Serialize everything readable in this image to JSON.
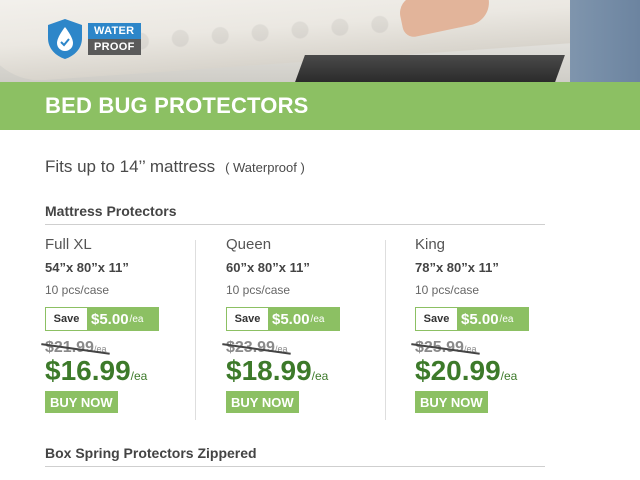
{
  "badge": {
    "line1": "WATER",
    "line2": "PROOF"
  },
  "banner": {
    "title": "BED BUG PROTECTORS"
  },
  "fits": {
    "text": "Fits up to 14’’ mattress",
    "note": "( Waterproof )"
  },
  "sections": {
    "mattress": "Mattress Protectors",
    "boxspring": "Box Spring Protectors Zippered"
  },
  "products": [
    {
      "name": "Full XL",
      "dims": "54”x 80”x 11”",
      "case": "10 pcs/case",
      "save_label": "Save",
      "save_amount": "$5.00",
      "unit": "/ea",
      "old_price": "$21.99",
      "price": "$16.99",
      "buy": "BUY NOW"
    },
    {
      "name": "Queen",
      "dims": "60”x 80”x 11”",
      "case": "10 pcs/case",
      "save_label": "Save",
      "save_amount": "$5.00",
      "unit": "/ea",
      "old_price": "$23.99",
      "price": "$18.99",
      "buy": "BUY NOW"
    },
    {
      "name": "King",
      "dims": "78”x 80”x 11”",
      "case": "10 pcs/case",
      "save_label": "Save",
      "save_amount": "$5.00",
      "unit": "/ea",
      "old_price": "$25.99",
      "price": "$20.99",
      "buy": "BUY NOW"
    }
  ],
  "colors": {
    "accent_green": "#8cc063",
    "price_green": "#3d7a2a",
    "badge_blue": "#2d86c9"
  },
  "icons": {
    "badge": "water-drop-shield-icon"
  }
}
